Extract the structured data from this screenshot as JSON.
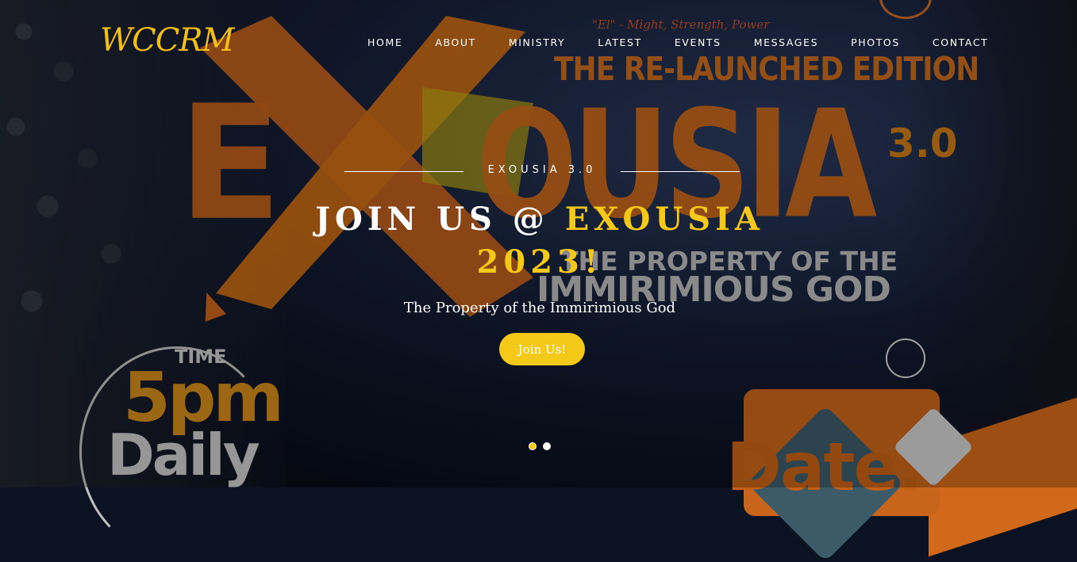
{
  "site": {
    "logo_text": "WCCRM"
  },
  "nav": {
    "items": [
      {
        "label": "HOME"
      },
      {
        "label": "ABOUT"
      },
      {
        "label": "MINISTRY"
      },
      {
        "label": "LATEST"
      },
      {
        "label": "EVENTS"
      },
      {
        "label": "MESSAGES"
      },
      {
        "label": "PHOTOS"
      },
      {
        "label": "CONTACT"
      }
    ]
  },
  "slide": {
    "eyebrow": "EXOUSIA 3.0",
    "headline_prefix": "JOIN US @ ",
    "headline_accent": "EXOUSIA 2023!",
    "tagline": "The Property of the Immirimious God",
    "cta_label": "Join Us!",
    "count": 2,
    "active_index": 0
  },
  "poster": {
    "subtitle": "\"El\" - Might, Strength, Power",
    "edition": "THE RE-LAUNCHED EDITION",
    "word_e": "E",
    "word_rest": "OUSIA",
    "version": "3.0",
    "tag_line1": "THE PROPERTY OF THE",
    "tag_line2": "IMMIRIMIOUS GOD",
    "time_label": "TIME",
    "time_value": "5pm",
    "time_daily": "Daily",
    "date_label": "Date:"
  },
  "colors": {
    "accent": "#f5c918",
    "poster_orange": "#c9681a",
    "text": "#ffffff"
  }
}
